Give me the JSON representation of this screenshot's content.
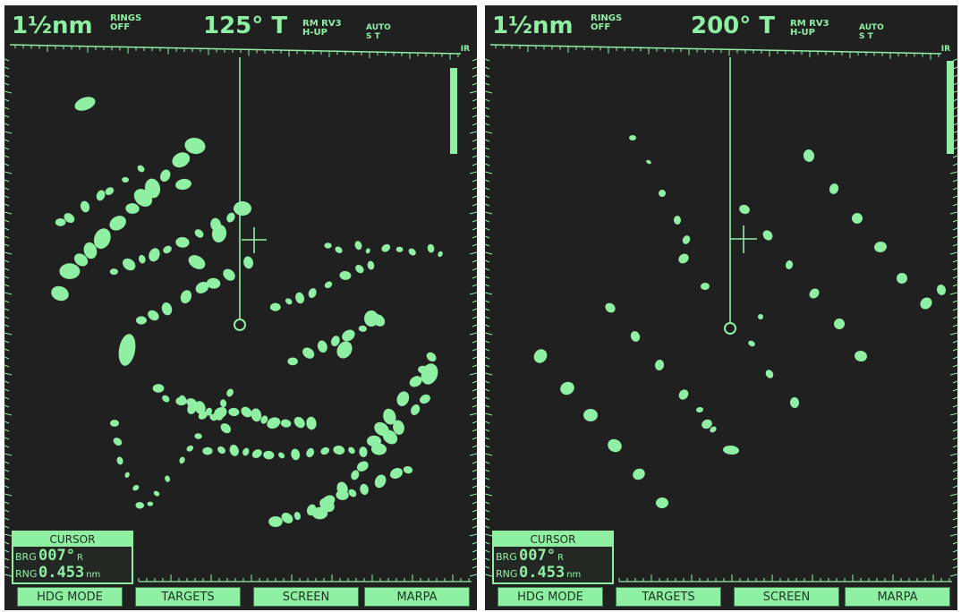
{
  "colors": {
    "phosphor": "#8ff0a4",
    "screen": "#202020",
    "softkey_text": "#1e3522"
  },
  "screens": [
    {
      "range": "1½nm",
      "rings": [
        "RINGS",
        "OFF"
      ],
      "heading": "125° T",
      "mode": [
        "RM RV3",
        "H-UP"
      ],
      "auto": [
        "AUTO",
        "S T"
      ],
      "ir": "IR",
      "cursor": {
        "title": "CURSOR",
        "brg_label": "BRG",
        "brg_value": "007°",
        "brg_unit": "R",
        "rng_label": "RNG",
        "rng_value": "0.453",
        "rng_unit": "nm"
      },
      "softkeys": [
        "HDG MODE",
        "TARGETS",
        "SCREEN",
        "MARPA"
      ]
    },
    {
      "range": "1½nm",
      "rings": [
        "RINGS",
        "OFF"
      ],
      "heading": "200° T",
      "mode": [
        "RM RV3",
        "H-UP"
      ],
      "auto": [
        "AUTO",
        "S T"
      ],
      "ir": "IR",
      "cursor": {
        "title": "CURSOR",
        "brg_label": "BRG",
        "brg_value": "007°",
        "brg_unit": "R",
        "rng_label": "RNG",
        "rng_value": "0.453",
        "rng_unit": "nm"
      },
      "softkeys": [
        "HDG MODE",
        "TARGETS",
        "SCREEN",
        "MARPA"
      ]
    }
  ]
}
